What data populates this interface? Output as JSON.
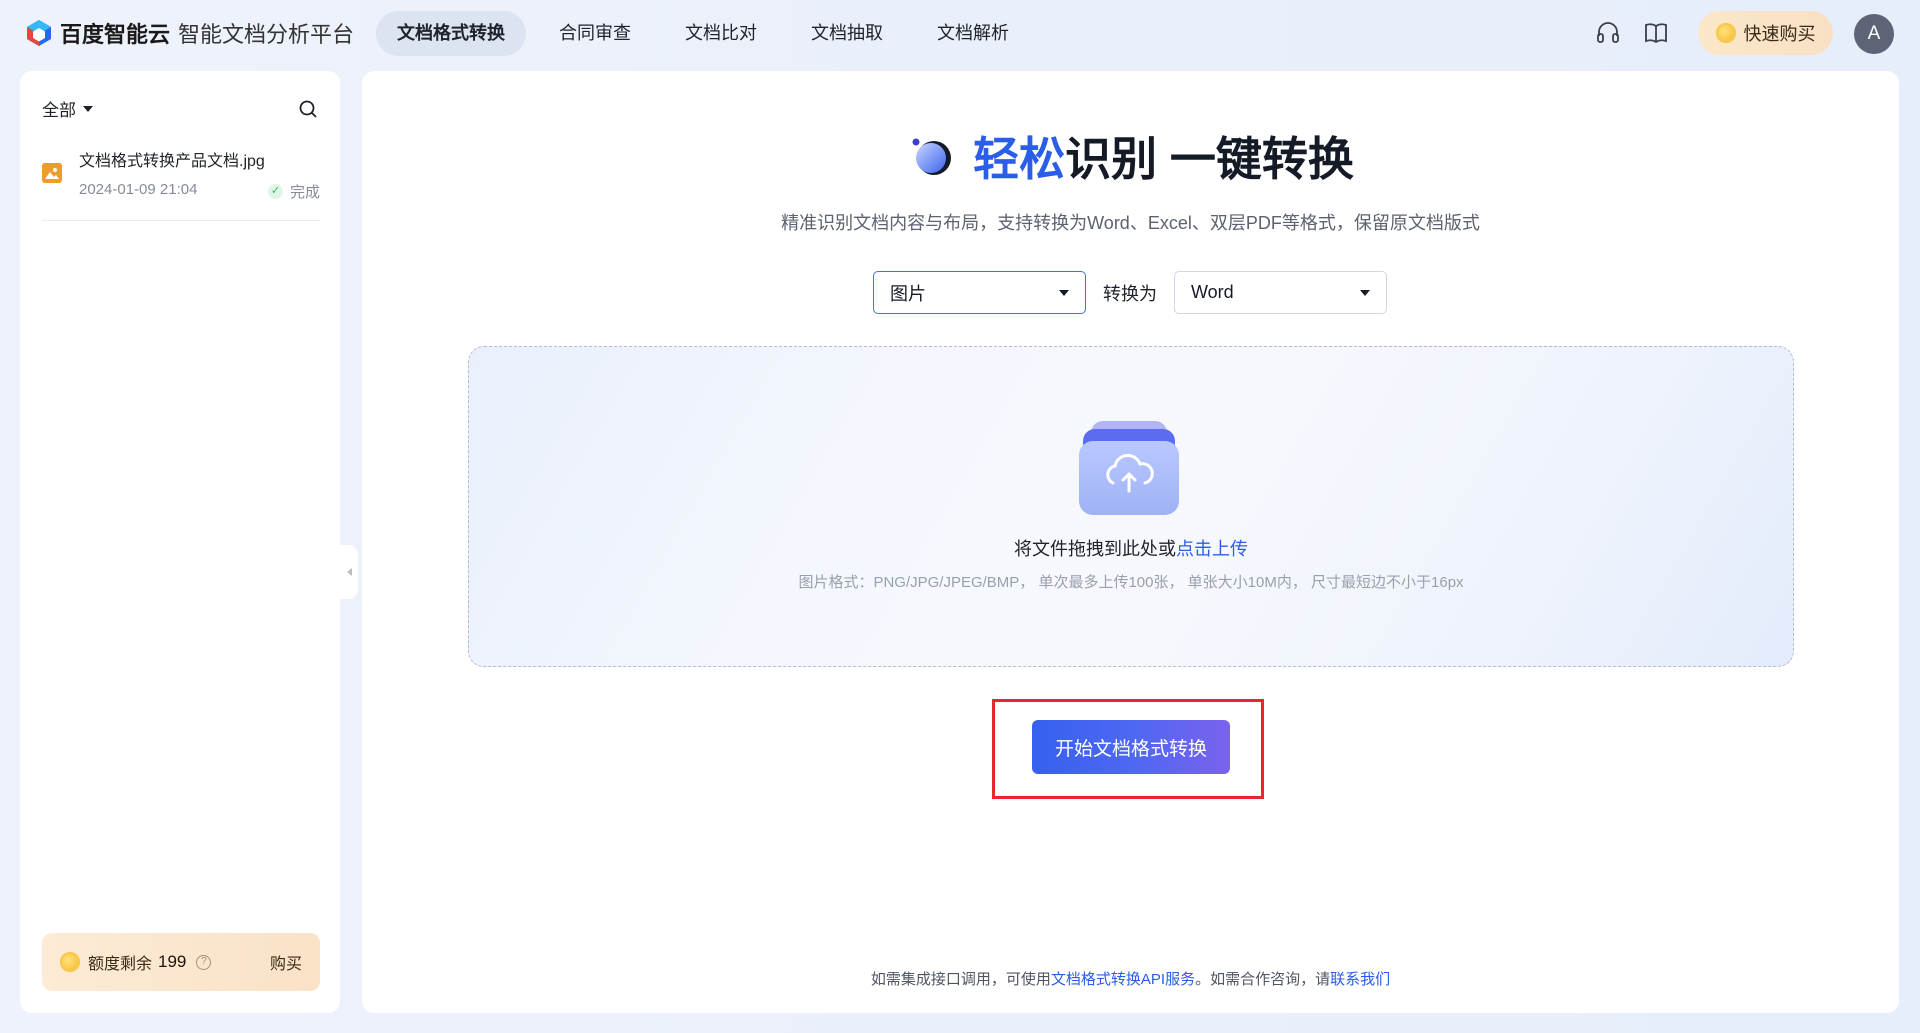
{
  "header": {
    "brand": "百度智能云",
    "product": "智能文档分析平台",
    "nav": [
      {
        "label": "文档格式转换",
        "active": true
      },
      {
        "label": "合同审查"
      },
      {
        "label": "文档比对"
      },
      {
        "label": "文档抽取"
      },
      {
        "label": "文档解析"
      }
    ],
    "support_icon": "headset-icon",
    "docs_icon": "book-icon",
    "buy_label": "快速购买",
    "avatar_letter": "A"
  },
  "sidebar": {
    "filter_label": "全部",
    "files": [
      {
        "name": "文档格式转换产品文档.jpg",
        "date": "2024-01-09 21:04",
        "status": "完成"
      }
    ],
    "quota": {
      "label": "额度剩余",
      "value": "199",
      "buy_label": "购买"
    }
  },
  "main": {
    "title_accent": "轻松",
    "title_rest": "识别 一键转换",
    "subtitle": "精准识别文档内容与布局，支持转换为Word、Excel、双层PDF等格式，保留原文档版式",
    "source_format": "图片",
    "convert_to_label": "转换为",
    "target_format": "Word",
    "upload": {
      "text": "将文件拖拽到此处或",
      "link": "点击上传",
      "hint": "图片格式：PNG/JPG/JPEG/BMP， 单次最多上传100张， 单张大小10M内， 尺寸最短边不小于16px"
    },
    "start_button": "开始文档格式转换",
    "footer": {
      "text1": "如需集成接口调用，可使用",
      "link1": "文档格式转换API服务",
      "text2": "。如需合作咨询，请",
      "link2": "联系我们"
    }
  },
  "colors": {
    "accent": "#2b5ee8",
    "highlight_box": "#e8262b"
  }
}
